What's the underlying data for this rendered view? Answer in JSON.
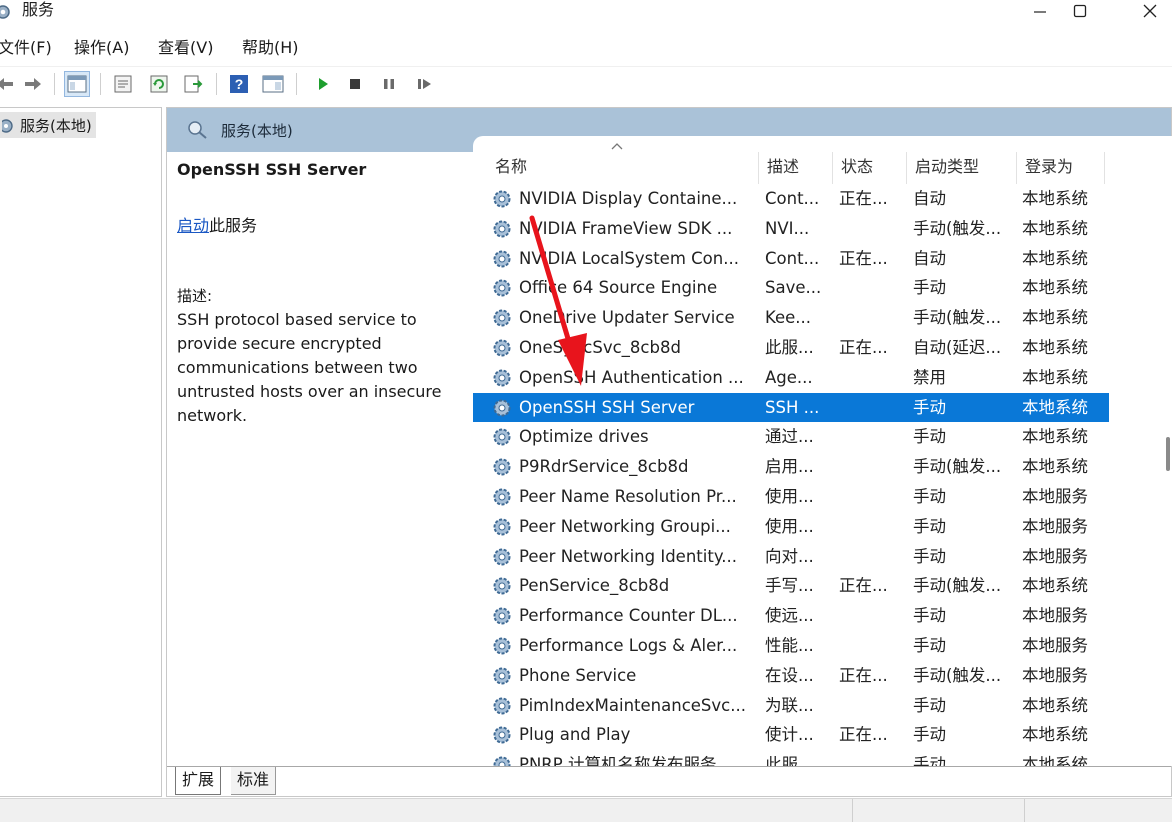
{
  "window": {
    "title": "服务",
    "icon": "services-gear-icon"
  },
  "menu": {
    "file": "文件(F)",
    "action": "操作(A)",
    "view": "查看(V)",
    "help": "帮助(H)"
  },
  "tree": {
    "root_label": "服务(本地)"
  },
  "main": {
    "header": "服务(本地)"
  },
  "details": {
    "service_title": "OpenSSH SSH Server",
    "start_link": "启动",
    "start_suffix": "此服务",
    "desc_label": "描述:",
    "desc_text": "SSH protocol based service to provide secure encrypted communications between two untrusted hosts over an insecure network."
  },
  "columns": {
    "name": "名称",
    "desc": "描述",
    "status": "状态",
    "startup": "启动类型",
    "logon": "登录为"
  },
  "rows": [
    {
      "name": "NVIDIA Display Containe...",
      "desc": "Cont...",
      "status": "正在...",
      "startup": "自动",
      "logon": "本地系统"
    },
    {
      "name": "NVIDIA FrameView SDK ...",
      "desc": "NVI...",
      "status": "",
      "startup": "手动(触发...",
      "logon": "本地系统"
    },
    {
      "name": "NVIDIA LocalSystem Con...",
      "desc": "Cont...",
      "status": "正在...",
      "startup": "自动",
      "logon": "本地系统"
    },
    {
      "name": "Office 64 Source Engine",
      "desc": "Save...",
      "status": "",
      "startup": "手动",
      "logon": "本地系统"
    },
    {
      "name": "OneDrive Updater Service",
      "desc": "Kee...",
      "status": "",
      "startup": "手动(触发...",
      "logon": "本地系统"
    },
    {
      "name": "OneSyncSvc_8cb8d",
      "desc": "此服...",
      "status": "正在...",
      "startup": "自动(延迟...",
      "logon": "本地系统"
    },
    {
      "name": "OpenSSH Authentication ...",
      "desc": "Age...",
      "status": "",
      "startup": "禁用",
      "logon": "本地系统"
    },
    {
      "name": "OpenSSH SSH Server",
      "desc": "SSH ...",
      "status": "",
      "startup": "手动",
      "logon": "本地系统"
    },
    {
      "name": "Optimize drives",
      "desc": "通过...",
      "status": "",
      "startup": "手动",
      "logon": "本地系统"
    },
    {
      "name": "P9RdrService_8cb8d",
      "desc": "启用...",
      "status": "",
      "startup": "手动(触发...",
      "logon": "本地系统"
    },
    {
      "name": "Peer Name Resolution Pr...",
      "desc": "使用...",
      "status": "",
      "startup": "手动",
      "logon": "本地服务"
    },
    {
      "name": "Peer Networking Groupi...",
      "desc": "使用...",
      "status": "",
      "startup": "手动",
      "logon": "本地服务"
    },
    {
      "name": "Peer Networking Identity...",
      "desc": "向对...",
      "status": "",
      "startup": "手动",
      "logon": "本地服务"
    },
    {
      "name": "PenService_8cb8d",
      "desc": "手写...",
      "status": "正在...",
      "startup": "手动(触发...",
      "logon": "本地系统"
    },
    {
      "name": "Performance Counter DL...",
      "desc": "使远...",
      "status": "",
      "startup": "手动",
      "logon": "本地服务"
    },
    {
      "name": "Performance Logs & Aler...",
      "desc": "性能...",
      "status": "",
      "startup": "手动",
      "logon": "本地服务"
    },
    {
      "name": "Phone Service",
      "desc": "在设...",
      "status": "正在...",
      "startup": "手动(触发...",
      "logon": "本地服务"
    },
    {
      "name": "PimIndexMaintenanceSvc...",
      "desc": "为联...",
      "status": "",
      "startup": "手动",
      "logon": "本地系统"
    },
    {
      "name": "Plug and Play",
      "desc": "使计...",
      "status": "正在...",
      "startup": "手动",
      "logon": "本地系统"
    },
    {
      "name": "PNRP 计算机名称发布服务",
      "desc": "此服...",
      "status": "",
      "startup": "手动",
      "logon": "本地系统"
    }
  ],
  "selected_index": 7,
  "tabs": {
    "extended": "扩展",
    "standard": "标准"
  },
  "colors": {
    "selection": "#0a78d7",
    "header_band": "#aac2d8",
    "link": "#1a57c3",
    "annotation_arrow": "#e8141c",
    "play_green": "#1e9e2e"
  }
}
